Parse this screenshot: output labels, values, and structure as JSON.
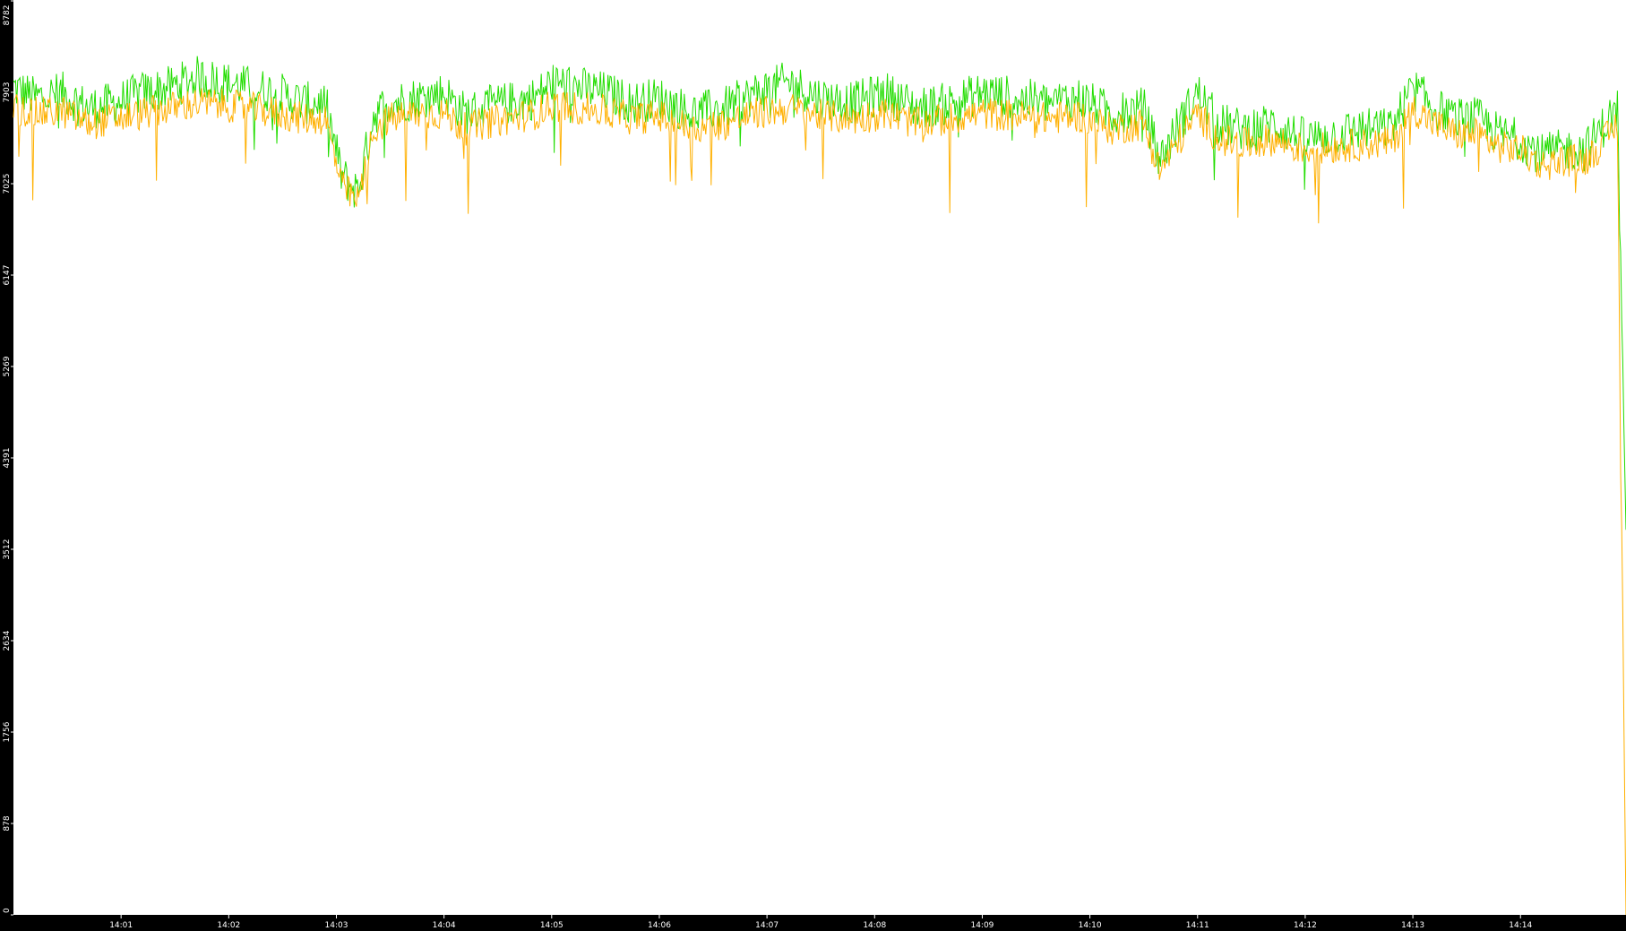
{
  "chart_data": {
    "type": "line",
    "title": "",
    "xlabel": "",
    "ylabel": "",
    "ylim": [
      0,
      8782
    ],
    "y_ticks": [
      "0",
      "878",
      "1756",
      "2634",
      "3512",
      "4391",
      "5269",
      "6147",
      "7025",
      "7903",
      "8782"
    ],
    "x_ticks": [
      "14:01",
      "14:02",
      "14:03",
      "14:04",
      "14:05",
      "14:06",
      "14:07",
      "14:08",
      "14:09",
      "14:10",
      "14:11",
      "14:12",
      "14:13",
      "14:14"
    ],
    "x_tick_positions": [
      1.0,
      2.0,
      3.0,
      4.0,
      5.0,
      6.0,
      7.0,
      8.0,
      9.0,
      10.0,
      11.0,
      12.0,
      13.0,
      14.0
    ],
    "xlim": [
      0.0,
      14.98
    ],
    "background": "#ffffff",
    "frame_color": "#000000",
    "series": [
      {
        "color": "#22dd00",
        "x": [
          0.0,
          0.2,
          0.45,
          0.7,
          0.95,
          1.2,
          1.45,
          1.7,
          1.95,
          2.2,
          2.45,
          2.7,
          2.9,
          3.05,
          3.2,
          3.35,
          3.5,
          3.75,
          4.0,
          4.2,
          4.35,
          4.6,
          4.85,
          5.0,
          5.25,
          5.5,
          5.75,
          6.0,
          6.3,
          6.6,
          6.9,
          7.2,
          7.5,
          7.8,
          8.1,
          8.4,
          8.7,
          9.0,
          9.3,
          9.6,
          9.9,
          10.2,
          10.5,
          10.65,
          10.8,
          11.0,
          11.2,
          11.4,
          11.7,
          12.0,
          12.3,
          12.5,
          12.8,
          13.0,
          13.2,
          13.4,
          13.6,
          13.8,
          14.0,
          14.2,
          14.4,
          14.6,
          14.75,
          14.9,
          14.98
        ],
        "values": [
          7950,
          7850,
          7900,
          7750,
          7800,
          7900,
          7950,
          8050,
          8000,
          7950,
          7900,
          7800,
          7800,
          7100,
          6950,
          7700,
          7800,
          7850,
          7900,
          7700,
          7750,
          7800,
          7850,
          8000,
          7950,
          7900,
          7800,
          7850,
          7700,
          7750,
          7900,
          8000,
          7850,
          7800,
          7900,
          7750,
          7800,
          7900,
          7850,
          7800,
          7850,
          7700,
          7750,
          7250,
          7550,
          7900,
          7600,
          7550,
          7600,
          7450,
          7500,
          7550,
          7550,
          7950,
          7750,
          7650,
          7650,
          7500,
          7450,
          7300,
          7350,
          7350,
          7550,
          7750,
          3700
        ]
      },
      {
        "color": "#ffb000",
        "x": [
          0.0,
          0.2,
          0.45,
          0.7,
          0.95,
          1.2,
          1.45,
          1.7,
          1.95,
          2.2,
          2.45,
          2.7,
          2.9,
          3.05,
          3.2,
          3.35,
          3.5,
          3.75,
          4.0,
          4.2,
          4.35,
          4.6,
          4.85,
          5.0,
          5.25,
          5.5,
          5.75,
          6.0,
          6.3,
          6.6,
          6.9,
          7.2,
          7.5,
          7.8,
          8.1,
          8.4,
          8.7,
          9.0,
          9.3,
          9.6,
          9.9,
          10.2,
          10.5,
          10.65,
          10.8,
          11.0,
          11.2,
          11.4,
          11.7,
          12.0,
          12.3,
          12.5,
          12.8,
          13.0,
          13.2,
          13.4,
          13.6,
          13.8,
          14.0,
          14.2,
          14.4,
          14.6,
          14.75,
          14.9,
          14.98
        ],
        "values": [
          7750,
          7700,
          7720,
          7600,
          7650,
          7700,
          7750,
          7800,
          7780,
          7750,
          7700,
          7650,
          7650,
          7000,
          6850,
          7550,
          7650,
          7700,
          7700,
          7550,
          7600,
          7650,
          7700,
          7780,
          7750,
          7720,
          7650,
          7680,
          7550,
          7600,
          7700,
          7750,
          7680,
          7650,
          7700,
          7600,
          7650,
          7700,
          7680,
          7650,
          7680,
          7550,
          7600,
          7150,
          7400,
          7700,
          7450,
          7400,
          7450,
          7350,
          7380,
          7400,
          7420,
          7750,
          7600,
          7500,
          7500,
          7380,
          7350,
          7200,
          7250,
          7250,
          7400,
          7600,
          0
        ]
      }
    ]
  }
}
